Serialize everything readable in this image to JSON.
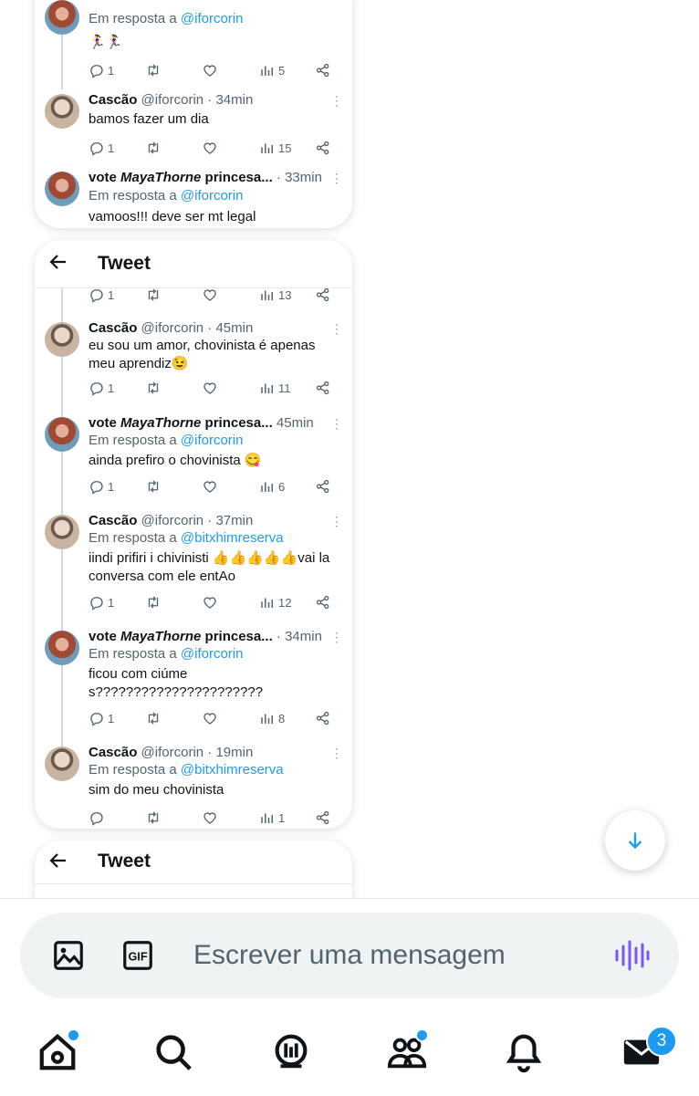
{
  "card1": {
    "tweets": [
      {
        "reply_prefix": "Em resposta a",
        "reply_handle": "@iforcorin",
        "text": "🏃‍♀️🏃‍♀️",
        "replies": "1",
        "views": "5"
      },
      {
        "name": "Cascão",
        "handle": "@iforcorin",
        "time": "· 34min",
        "text": "bamos fazer um dia",
        "replies": "1",
        "views": "15"
      },
      {
        "name_prefix": "vote ",
        "name_italic": "MayaThorne",
        "name_suffix": " princesa...",
        "time": "· 33min",
        "reply_prefix": "Em resposta a",
        "reply_handle": "@iforcorin",
        "text": "vamoos!!! deve ser mt legal"
      }
    ]
  },
  "card2": {
    "header_title": "Tweet",
    "top_actions": {
      "replies": "1",
      "views": "13"
    },
    "tweets": [
      {
        "name": "Cascão",
        "handle": "@iforcorin",
        "time": "· 45min",
        "text": "eu sou um amor, chovinista é apenas meu aprendiz😉",
        "replies": "1",
        "views": "11"
      },
      {
        "name_prefix": "vote ",
        "name_italic": "MayaThorne",
        "name_suffix": " princesa...",
        "time": "45min",
        "reply_prefix": "Em resposta a",
        "reply_handle": "@iforcorin",
        "text": "ainda prefiro o chovinista 😋",
        "replies": "1",
        "views": "6"
      },
      {
        "name": "Cascão",
        "handle": "@iforcorin",
        "time": "· 37min",
        "reply_prefix": "Em resposta a",
        "reply_handle": "@bitxhimreserva",
        "text": "iindi prifiri i chivinisti 👍👍👍👍👍vai la conversa com ele entAo",
        "replies": "1",
        "views": "12"
      },
      {
        "name_prefix": "vote ",
        "name_italic": "MayaThorne",
        "name_suffix": " princesa...",
        "time": "· 34min",
        "reply_prefix": "Em resposta a",
        "reply_handle": "@iforcorin",
        "text": "ficou com ciúmes??????????????????????",
        "replies": "1",
        "views": "8"
      },
      {
        "name": "Cascão",
        "handle": "@iforcorin",
        "time": "· 19min",
        "reply_prefix": "Em resposta a",
        "reply_handle": "@bitxhimreserva",
        "text": "sim do meu chovinista",
        "replies": "",
        "views": "1"
      }
    ]
  },
  "card3": {
    "header_title": "Tweet"
  },
  "composer": {
    "placeholder": "Escrever uma mensagem"
  },
  "nav": {
    "messages_badge": "3"
  },
  "colors": {
    "accent": "#1d9bf0",
    "text": "#0f1419",
    "muted": "#536471",
    "voice": "#7856ff"
  },
  "icons": [
    "back-arrow-icon",
    "more-dots-icon",
    "reply-icon",
    "retweet-icon",
    "like-icon",
    "views-icon",
    "share-icon",
    "scroll-down-arrow-icon",
    "image-icon",
    "gif-icon",
    "voice-icon",
    "home-icon",
    "search-icon",
    "spaces-icon",
    "communities-icon",
    "notifications-icon",
    "messages-icon"
  ]
}
